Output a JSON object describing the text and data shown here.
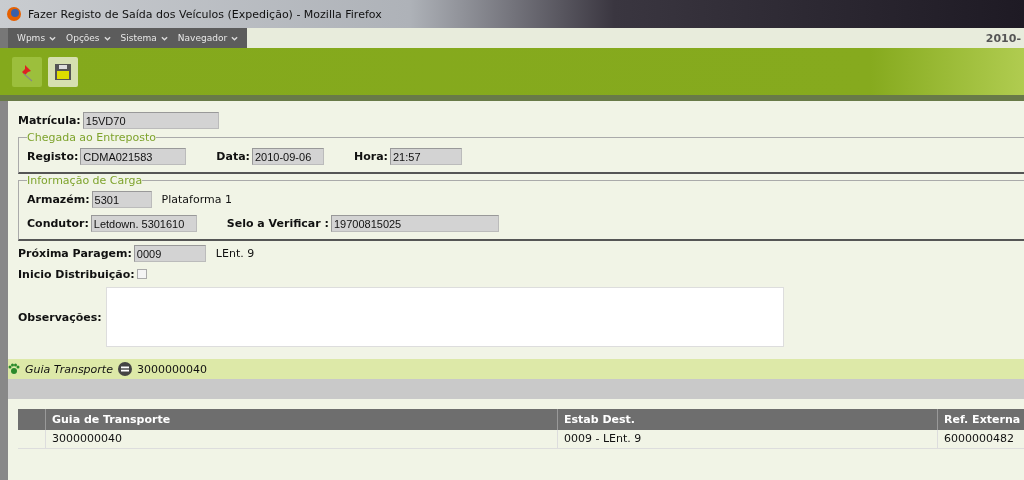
{
  "window": {
    "title": "Fazer Registo de Saída dos Veículos (Expedição) - Mozilla Firefox"
  },
  "menu": [
    {
      "label": "Wpms"
    },
    {
      "label": "Opções"
    },
    {
      "label": "Sistema"
    },
    {
      "label": "Navegador"
    }
  ],
  "date": "2010-",
  "form": {
    "matricula": {
      "label": "Matrícula:",
      "value": "15VD70"
    },
    "fieldsets": [
      {
        "legend": "Chegada ao Entreposto",
        "rows": [
          [
            {
              "label": "Registo:",
              "value": "CDMA021583"
            },
            {
              "label": "Data:",
              "value": "2010-09-06"
            },
            {
              "label": "Hora:",
              "value": "21:57"
            }
          ]
        ]
      },
      {
        "legend": "Informação de Carga",
        "rows": [
          [
            {
              "label": "Armazém:",
              "value": "5301",
              "note": "Plataforma 1"
            }
          ],
          [
            {
              "label": "Condutor:",
              "value": "Letdown. 5301610"
            },
            {
              "label": "Selo a Verificar :",
              "value": "19700815025"
            }
          ]
        ]
      }
    ],
    "proxima": {
      "label": "Próxima Paragem:",
      "value": "0009",
      "note": "LEnt. 9"
    },
    "inicio": {
      "label": "Inicio Distribuição:",
      "checked": false
    },
    "observacoes": {
      "label": "Observações:"
    }
  },
  "guia": {
    "label": "Guia Transporte",
    "value": "3000000040"
  },
  "table": {
    "columns": [
      "Guia de Transporte",
      "Estab Dest.",
      "Ref. Externa"
    ],
    "rows": [
      [
        "3000000040",
        "0009 - LEnt. 9",
        "6000000482"
      ]
    ]
  }
}
